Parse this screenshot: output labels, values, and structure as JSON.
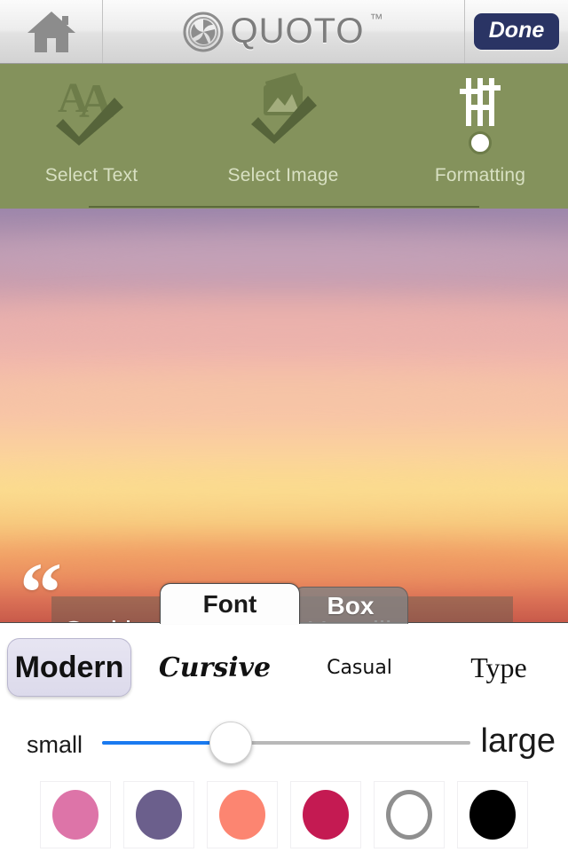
{
  "app": {
    "brand": "QUOTO",
    "trademark": "™"
  },
  "topbar": {
    "home_icon": "home-icon",
    "logo_icon": "aperture-icon",
    "done_label": "Done"
  },
  "stepper": {
    "background": "#84925c",
    "steps": [
      {
        "label": "Select Text",
        "icon": "text-aa-icon",
        "state": "completed"
      },
      {
        "label": "Select Image",
        "icon": "photo-icon",
        "state": "completed"
      },
      {
        "label": "Formatting",
        "icon": "sliders-icon",
        "state": "current"
      }
    ]
  },
  "canvas": {
    "quote_open": "“",
    "quote_close": "”",
    "quote_text": "God has promised He will never leave you nor forsake you. No matter what you are going through in life, you do not have to go through it alone.",
    "box_overlay_color": "rgba(90,92,80,.45)"
  },
  "tabs": [
    {
      "label": "Font",
      "active": true
    },
    {
      "label": "Box",
      "active": false
    }
  ],
  "panel": {
    "fonts": [
      {
        "label": "Modern",
        "selected": true
      },
      {
        "label": "Cursive",
        "selected": false
      },
      {
        "label": "Casual",
        "selected": false
      },
      {
        "label": "Type",
        "selected": false
      }
    ],
    "size_slider": {
      "min_label": "small",
      "max_label": "large",
      "value_percent": 35,
      "fill_color": "#1a7af0",
      "track_color": "#b8b8b8"
    },
    "colors": [
      {
        "name": "pink",
        "hex": "#dd74a8",
        "selected": false
      },
      {
        "name": "purple",
        "hex": "#6b5f8c",
        "selected": false
      },
      {
        "name": "coral",
        "hex": "#fc8571",
        "selected": false
      },
      {
        "name": "crimson",
        "hex": "#c41a52",
        "selected": false
      },
      {
        "name": "white",
        "hex": "#ffffff",
        "selected": false
      },
      {
        "name": "black",
        "hex": "#000000",
        "selected": false
      }
    ]
  }
}
